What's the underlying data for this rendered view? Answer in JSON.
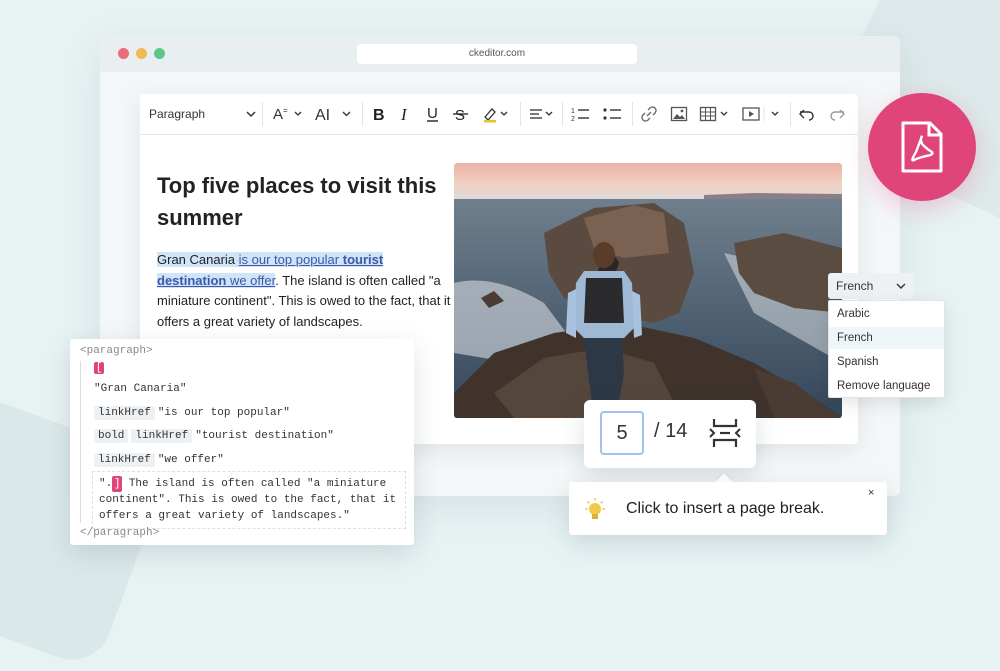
{
  "browser": {
    "url": "ckeditor.com"
  },
  "toolbar": {
    "heading": "Paragraph",
    "items": [
      "font-size",
      "font-family",
      "bold",
      "italic",
      "underline",
      "strikethrough",
      "highlight",
      "alignment",
      "numbered-list",
      "bulleted-list",
      "link",
      "image",
      "table",
      "media",
      "undo",
      "redo"
    ]
  },
  "document": {
    "title": "Top five places to visit this summer",
    "para": {
      "t1": "Gran Canaria ",
      "link1": "is our top popular ",
      "link2": "tourist",
      "link3": "destination",
      "link4": " we offer",
      "t2": ". The island is often called \"a miniature continent\". This is owed to the fact, that it offers a great variety of landscapes."
    }
  },
  "language": {
    "selected": "French",
    "options": [
      "Arabic",
      "French",
      "Spanish",
      "Remove language"
    ]
  },
  "source": {
    "open_tag": "<paragraph>",
    "close_tag": "</paragraph>",
    "text1": "\"Gran Canaria\"",
    "attr_link": "linkHref",
    "attr_bold": "bold",
    "text2": "\"is our top popular\"",
    "text3": "\"tourist destination\"",
    "text4": "\"we offer\"",
    "text5_prefix": "\".",
    "text5": "The island is often called \"a miniature continent\". This is owed to the fact, that it offers a great variety of landscapes.\""
  },
  "pagenav": {
    "current": "5",
    "total": "/ 14"
  },
  "tooltip": {
    "text": "Click to insert a page break.",
    "close": "×"
  },
  "colors": {
    "accent_pink": "#e0457a",
    "selection": "#cfe4f7",
    "link": "#3b59a8"
  }
}
